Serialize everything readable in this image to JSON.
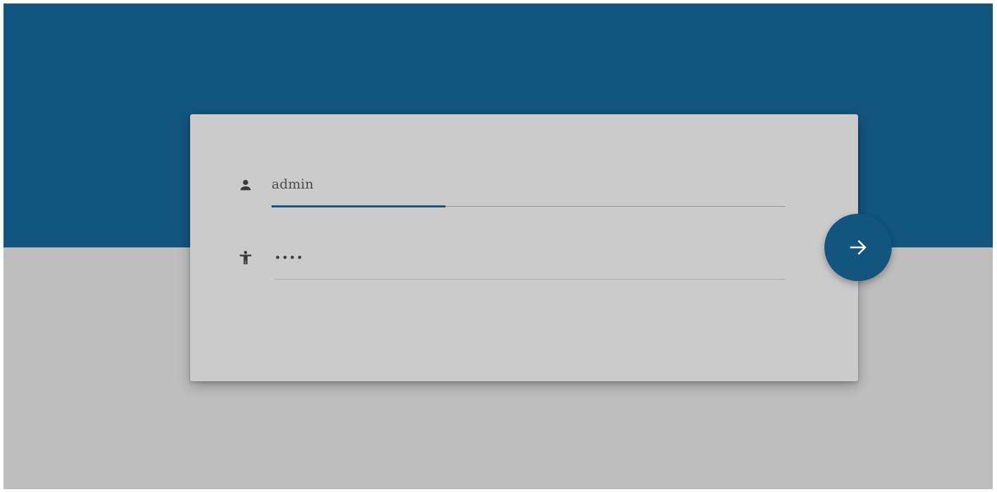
{
  "login": {
    "username": {
      "icon": "person-icon",
      "value": "admin"
    },
    "password": {
      "icon": "accessibility-icon",
      "value": "••••"
    },
    "submit": {
      "icon": "arrow-right-icon"
    }
  },
  "colors": {
    "primary": "#12557f",
    "background_lower": "#bebebe",
    "card": "#cbcbcb"
  }
}
